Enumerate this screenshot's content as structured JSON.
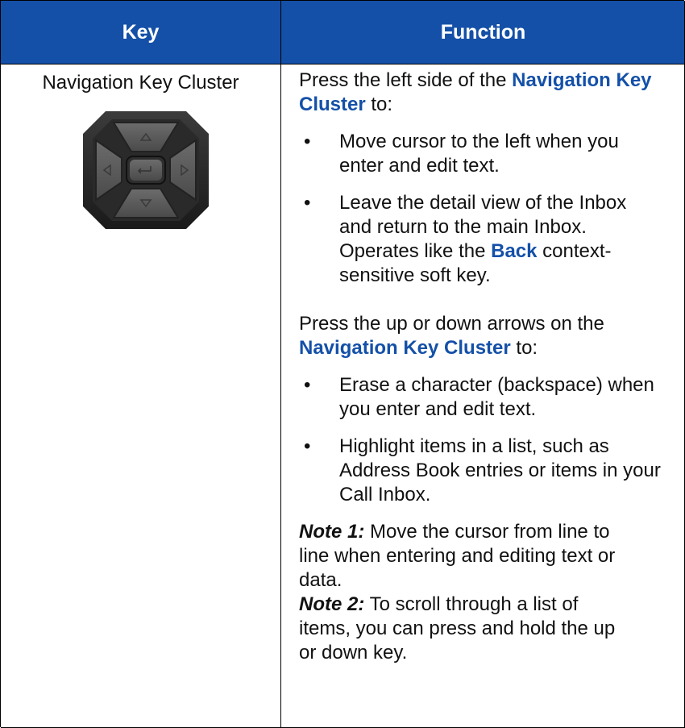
{
  "table": {
    "headers": {
      "key": "Key",
      "function": "Function"
    },
    "key_name": "Navigation Key Cluster",
    "function": {
      "para1": {
        "before": "Press the left side of the ",
        "link": "Navigation Key Cluster",
        "after": " to:"
      },
      "bullets1": [
        {
          "text": "Move cursor to the left when you enter and edit text."
        },
        {
          "before": "Leave the detail view of the Inbox and return to the main Inbox. Operates like the ",
          "link": "Back",
          "after": " context-sensitive soft key."
        }
      ],
      "para2": {
        "before": "Press the up or down arrows on the ",
        "link": "Navigation Key Cluster",
        "after": " to:"
      },
      "bullets2": [
        {
          "text": "Erase a character (backspace) when you enter and edit text."
        },
        {
          "text": "Highlight items in a list, such as Address Book entries or items in your Call Inbox."
        }
      ],
      "notes": [
        {
          "label": "Note 1:",
          "text": " Move the cursor from line to line when entering and editing text or data."
        },
        {
          "label": "Note 2:",
          "text": "  To scroll through a list of items, you can press and hold the up or down key."
        }
      ],
      "bullet_char": "•"
    }
  },
  "colors": {
    "header_bg": "#1450a8",
    "link": "#1450a8"
  },
  "icons": {
    "keypad": "navigation-key-cluster-image"
  }
}
